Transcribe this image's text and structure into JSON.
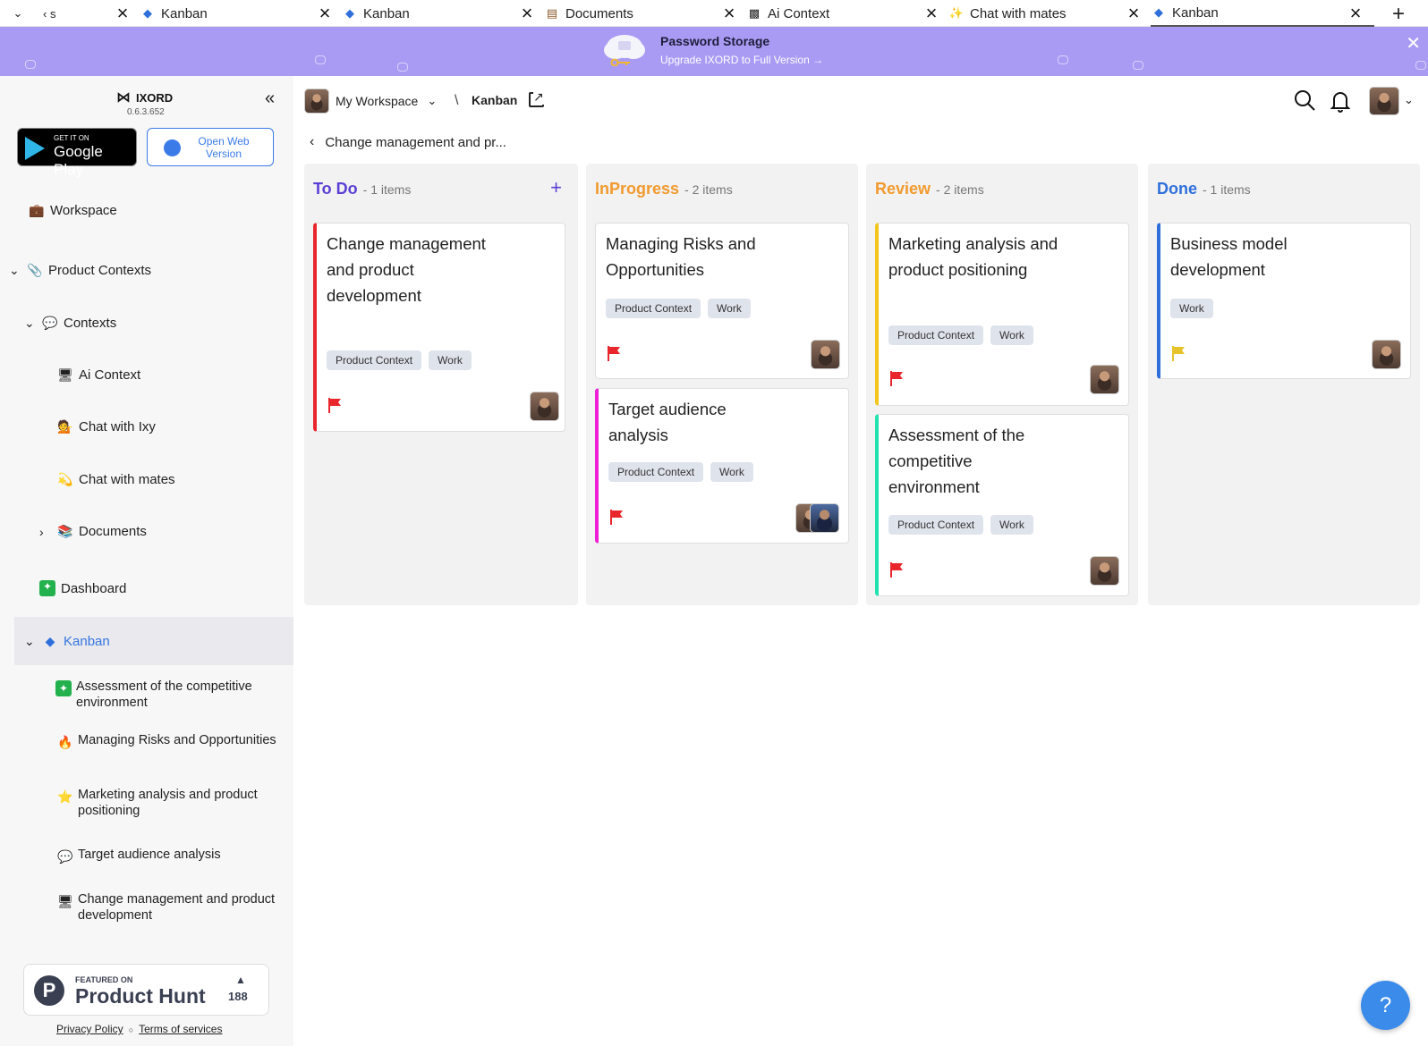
{
  "tabs": [
    {
      "label": "‹ s",
      "icon": "chevron-left-icon"
    },
    {
      "label": "Kanban",
      "icon": "diamond-icon"
    },
    {
      "label": "Kanban",
      "icon": "diamond-icon"
    },
    {
      "label": "Documents",
      "icon": "books-icon"
    },
    {
      "label": "Ai Context",
      "icon": "monitor-icon"
    },
    {
      "label": "Chat with mates",
      "icon": "comet-icon"
    },
    {
      "label": "Kanban",
      "icon": "diamond-icon",
      "active": true
    }
  ],
  "banner": {
    "title": "Password Storage",
    "subtitle": "Upgrade IXORD to Full Version →",
    "color": "#a99bf4"
  },
  "sidebar": {
    "brand": "IXORD",
    "version": "0.6.3.652",
    "google_play_small": "GET IT ON",
    "google_play_big": "Google Play",
    "open_web": "Open Web Version",
    "nav": {
      "workspace": "Workspace",
      "product_contexts": "Product Contexts",
      "contexts": "Contexts",
      "ai_context": "Ai Context",
      "chat_ixy": "Chat with Ixy",
      "chat_mates": "Chat with mates",
      "documents": "Documents",
      "dashboard": "Dashboard",
      "kanban": "Kanban"
    },
    "kanban_items": [
      {
        "label": "Assessment of the competitive environment",
        "icon": "sparkle-icon"
      },
      {
        "label": "Managing Risks and Opportunities",
        "icon": "fire-icon"
      },
      {
        "label": "Marketing analysis and product positioning",
        "icon": "star-icon"
      },
      {
        "label": "Target audience analysis",
        "icon": "speech-bubble-icon"
      },
      {
        "label": "Change management and product development",
        "icon": "monitor-icon"
      }
    ],
    "producthunt": {
      "featured": "FEATURED ON",
      "name": "Product Hunt",
      "count": "188"
    },
    "privacy": "Privacy Policy",
    "terms": "Terms of services"
  },
  "header": {
    "workspace": "My Workspace",
    "separator": "\\",
    "crumb": "Kanban",
    "back_label": "Change management and pr..."
  },
  "board": {
    "accent": "#5b3fd6",
    "columns": [
      {
        "title": "To Do",
        "count": "- 1 items",
        "color": "#5b3fd6",
        "cards": [
          {
            "title": "Change management and product development",
            "tags": [
              "Product Context",
              "Work"
            ],
            "stripe": "#e8262c",
            "flag": "#e8262c"
          }
        ]
      },
      {
        "title": "InProgress",
        "count": "- 2 items",
        "color": "#f29a2e",
        "cards": [
          {
            "title": "Managing Risks and Opportunities",
            "tags": [
              "Product Context",
              "Work"
            ],
            "stripe": "#dedede",
            "flag": "#e8262c"
          },
          {
            "title": "Target audience analysis",
            "tags": [
              "Product Context",
              "Work"
            ],
            "stripe": "#ee1fd7",
            "flag": "#e8262c"
          }
        ]
      },
      {
        "title": "Review",
        "count": "- 2 items",
        "color": "#f29a2e",
        "cards": [
          {
            "title": "Marketing analysis and product positioning",
            "tags": [
              "Product Context",
              "Work"
            ],
            "stripe": "#f2c61f",
            "flag": "#e8262c"
          },
          {
            "title": "Assessment of the competitive environment",
            "tags": [
              "Product Context",
              "Work"
            ],
            "stripe": "#22e3b0",
            "flag": "#e8262c"
          }
        ]
      },
      {
        "title": "Done",
        "count": "- 1 items",
        "color": "#2f6fdc",
        "cards": [
          {
            "title": "Business model development",
            "tags": [
              "Work"
            ],
            "stripe": "#2f6fdc",
            "flag": "#e6c32a"
          }
        ]
      }
    ]
  },
  "help": "?"
}
